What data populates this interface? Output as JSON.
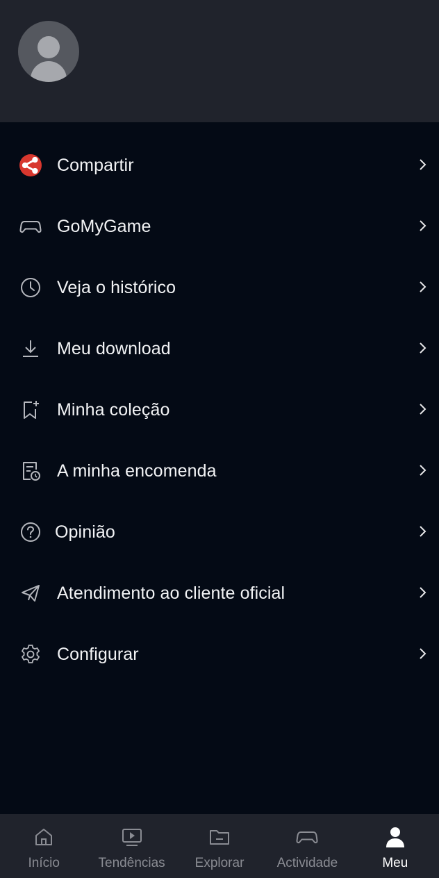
{
  "menu": [
    {
      "label": "Compartir",
      "icon": "share-icon"
    },
    {
      "label": "GoMyGame",
      "icon": "gamepad-icon"
    },
    {
      "label": "Veja o histórico",
      "icon": "clock-icon"
    },
    {
      "label": "Meu download",
      "icon": "download-icon"
    },
    {
      "label": "Minha coleção",
      "icon": "bookmark-add-icon"
    },
    {
      "label": "A minha encomenda",
      "icon": "order-icon"
    },
    {
      "label": "Opinião",
      "icon": "help-circle-icon"
    },
    {
      "label": "Atendimento ao cliente oficial",
      "icon": "send-icon"
    },
    {
      "label": "Configurar",
      "icon": "gear-icon"
    }
  ],
  "tabs": [
    {
      "label": "Início",
      "icon": "home-icon"
    },
    {
      "label": "Tendências",
      "icon": "play-screen-icon"
    },
    {
      "label": "Explorar",
      "icon": "folder-icon"
    },
    {
      "label": "Actividade",
      "icon": "gamepad-icon"
    },
    {
      "label": "Meu",
      "icon": "person-icon",
      "active": true
    }
  ],
  "colors": {
    "background": "#040a15",
    "header": "#20232c",
    "share_accent": "#d8372e",
    "tab_inactive": "#8a8c93",
    "tab_active": "#ffffff"
  }
}
